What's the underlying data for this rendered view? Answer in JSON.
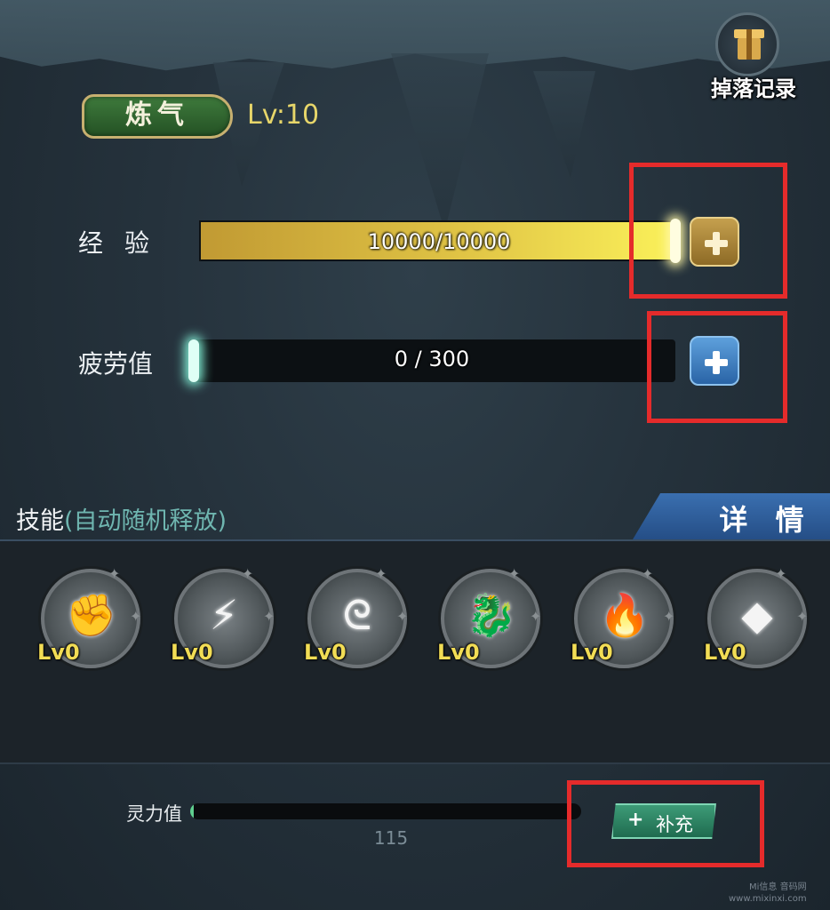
{
  "header": {
    "drop_record_label": "掉落记录",
    "drop_icon": "gift-box-icon"
  },
  "cultivation": {
    "realm": "炼气",
    "level": "Lv:10"
  },
  "experience": {
    "label": "经验",
    "current": 10000,
    "max": 10000,
    "text": "10000/10000",
    "fill_fraction": 1.0
  },
  "fatigue": {
    "label": "疲劳值",
    "current": 0,
    "max": 300,
    "text": "0 / 300",
    "fill_fraction": 0.0
  },
  "skills": {
    "title": "技能",
    "subtitle": "(自动随机释放)",
    "detail_label": "详 情",
    "items": [
      {
        "level": "Lv0",
        "icon": "fist-icon"
      },
      {
        "level": "Lv0",
        "icon": "lightning-strike-icon"
      },
      {
        "level": "Lv0",
        "icon": "swirl-icon"
      },
      {
        "level": "Lv0",
        "icon": "dragon-icon"
      },
      {
        "level": "Lv0",
        "icon": "flame-icon"
      },
      {
        "level": "Lv0",
        "icon": "rock-burst-icon"
      }
    ]
  },
  "spirit": {
    "label": "灵力值",
    "value": "115",
    "fill_fraction": 0.01,
    "refill_label": "补充",
    "refill_icon": "drop-plus-icon"
  },
  "watermark": {
    "line1": "Mi信息 音码网",
    "line2": "www.mixinxi.com"
  },
  "colors": {
    "highlight": "#e52b2b",
    "exp_fill": "#e0c445",
    "fatigue_plus": "#2a64a6",
    "exp_plus": "#8d6a26",
    "level_text": "#e7d66a"
  }
}
